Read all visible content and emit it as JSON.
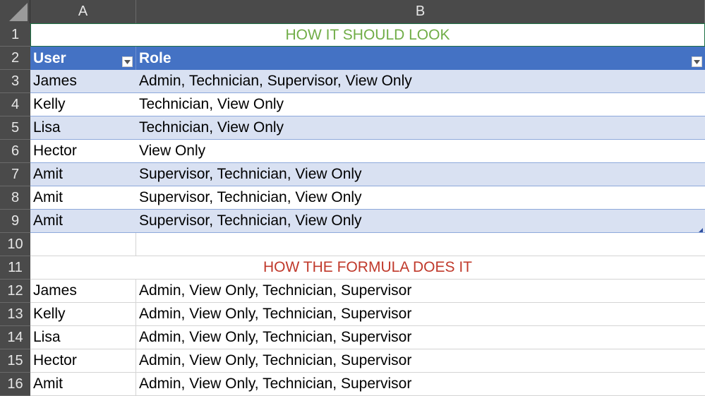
{
  "columns": [
    "A",
    "B"
  ],
  "top_title": {
    "text": "HOW IT SHOULD LOOK",
    "color": "#70ad47"
  },
  "bottom_title": {
    "text": "HOW THE FORMULA DOES IT",
    "color": "#c0392b"
  },
  "table_header": {
    "user": "User",
    "role": "Role"
  },
  "table_rows": [
    {
      "row": "3",
      "user": "James",
      "role": "Admin, Technician, Supervisor, View Only"
    },
    {
      "row": "4",
      "user": "Kelly",
      "role": "Technician, View Only"
    },
    {
      "row": "5",
      "user": "Lisa",
      "role": "Technician, View Only"
    },
    {
      "row": "6",
      "user": "Hector",
      "role": "View Only"
    },
    {
      "row": "7",
      "user": "Amit",
      "role": "Supervisor, Technician, View Only"
    },
    {
      "row": "8",
      "user": "Amit",
      "role": "Supervisor, Technician, View Only"
    },
    {
      "row": "9",
      "user": "Amit",
      "role": "Supervisor, Technician, View Only"
    }
  ],
  "formula_rows": [
    {
      "row": "12",
      "user": "James",
      "role": "Admin, View Only, Technician, Supervisor"
    },
    {
      "row": "13",
      "user": "Kelly",
      "role": "Admin, View Only, Technician, Supervisor"
    },
    {
      "row": "14",
      "user": "Lisa",
      "role": "Admin, View Only, Technician, Supervisor"
    },
    {
      "row": "15",
      "user": "Hector",
      "role": "Admin, View Only, Technician, Supervisor"
    },
    {
      "row": "16",
      "user": "Amit",
      "role": "Admin, View Only, Technician, Supervisor"
    }
  ],
  "row_numbers": {
    "r1": "1",
    "r2": "2",
    "r10": "10",
    "r11": "11"
  },
  "colors": {
    "table_header": "#4472c4",
    "band": "#d9e1f2",
    "header_bar": "#4a4a4a"
  }
}
